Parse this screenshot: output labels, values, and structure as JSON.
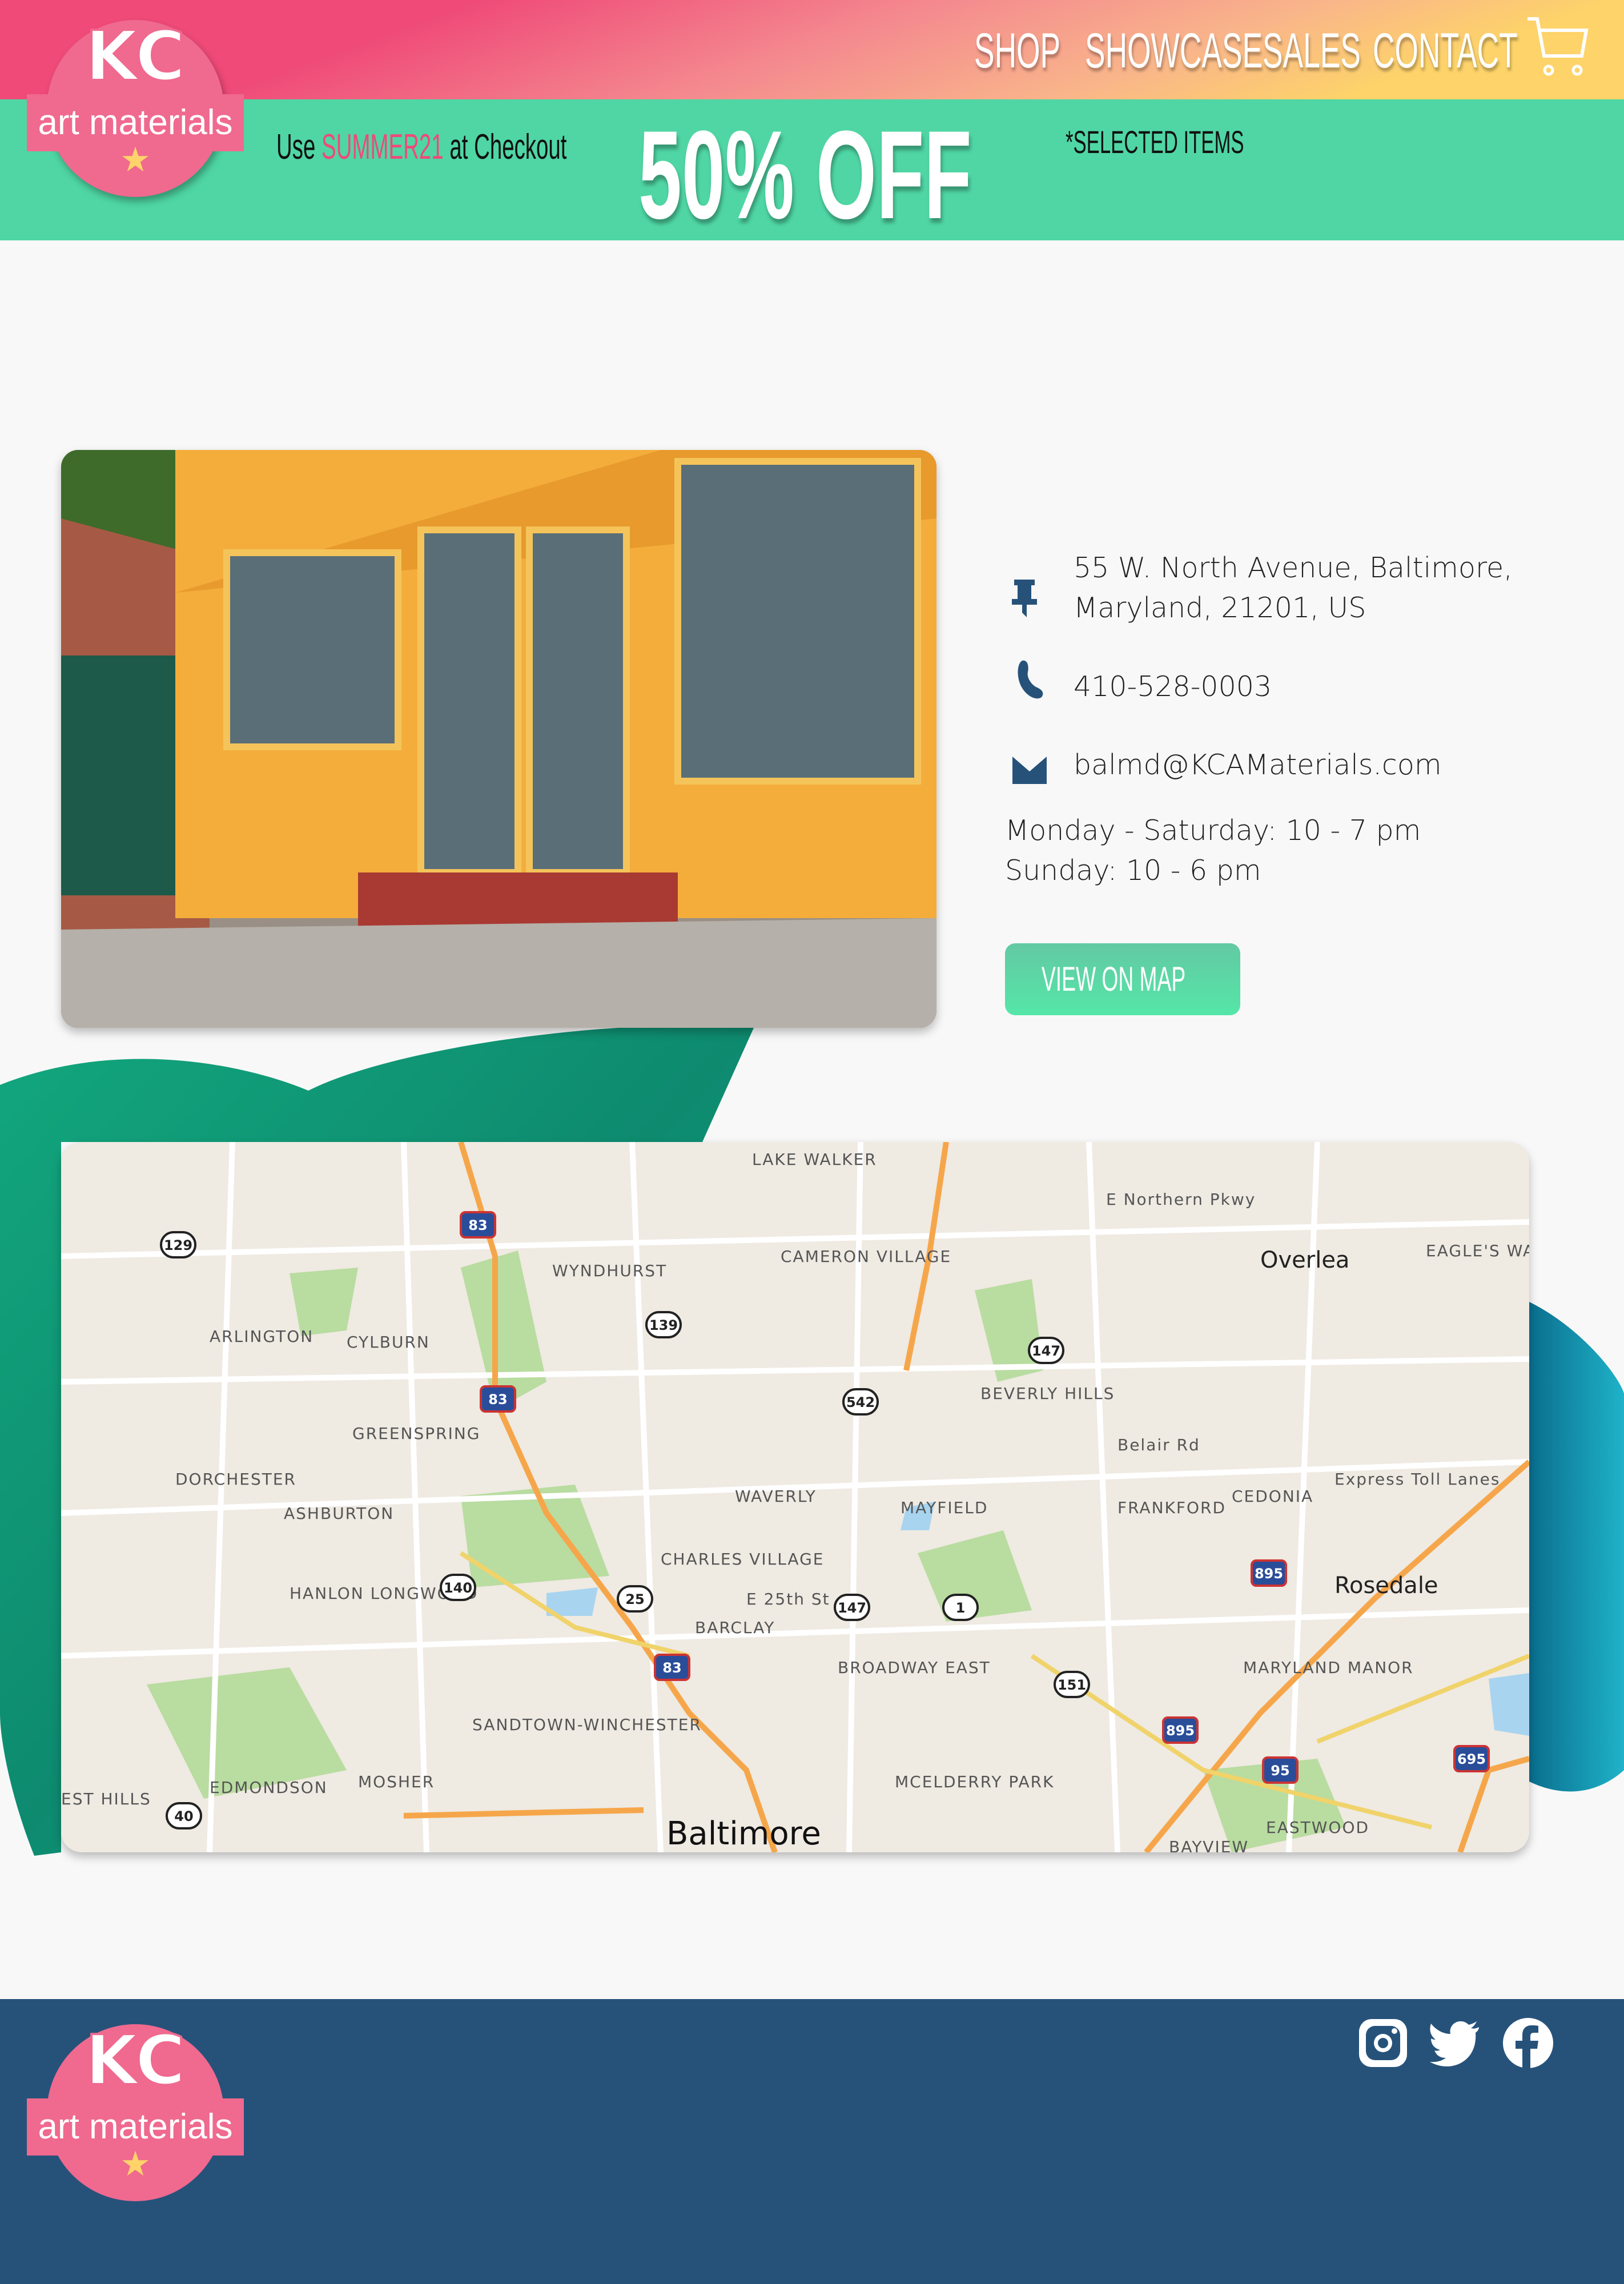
{
  "header": {
    "brand_logo_text": "KC art materials",
    "nav": [
      "SHOP",
      "SHOWCASE",
      "SALES",
      "CONTACT"
    ],
    "cart_icon": "shopping-cart-icon"
  },
  "promo": {
    "use": "Use",
    "code": "SUMMER21",
    "at_checkout": "at Checkout",
    "headline": "50% OFF",
    "note": "*SELECTED ITEMS",
    "code_color": "#ef4a78",
    "background": "#4fd6a4"
  },
  "contact": {
    "address_line1": "55 W. North Avenue, Baltimore,",
    "address_line2": "Maryland, 21201, US",
    "phone": "410-528-0003",
    "email": "balmd@KCAMaterials.com",
    "hours_weekdays": "Monday - Saturday: 10 - 7 pm",
    "hours_sunday": "Sunday: 10 - 6 pm",
    "view_map_button": "VIEW ON MAP",
    "icons": [
      "pushpin-icon",
      "phone-icon",
      "envelope-icon"
    ]
  },
  "map": {
    "labels": [
      "LAKE WALKER",
      "CAMERON VILLAGE",
      "WYNDHURST",
      "E Northern Pkwy",
      "Overlea",
      "EAGLE'S WAY AT WHITE MARSH",
      "ARLINGTON",
      "CYLBURN",
      "BEVERLY HILLS",
      "Belair Rd",
      "Express Toll Lanes",
      "GREENSPRING",
      "DORCHESTER",
      "ASHBURTON",
      "WAVERLY",
      "MAYFIELD",
      "FRANKFORD",
      "CEDONIA",
      "CHARLES VILLAGE",
      "HANLON LONGWOOD",
      "E 25th St",
      "BARCLAY",
      "Rosedale",
      "BROADWAY EAST",
      "MARYLAND MANOR",
      "SANDTOWN-WINCHESTER",
      "MCELDERRY PARK",
      "EDMONDSON",
      "MOSHER",
      "EST HILLS",
      "EASTWOOD",
      "BAYVIEW",
      "Baltimore"
    ],
    "shields": [
      "83",
      "129",
      "139",
      "147",
      "542",
      "83",
      "140",
      "25",
      "147",
      "1",
      "83",
      "151",
      "895",
      "895",
      "95",
      "695",
      "40"
    ]
  },
  "footer": {
    "brand_logo_text": "KC art materials",
    "social": [
      "instagram-icon",
      "twitter-icon",
      "facebook-icon"
    ],
    "background": "#26527a"
  }
}
